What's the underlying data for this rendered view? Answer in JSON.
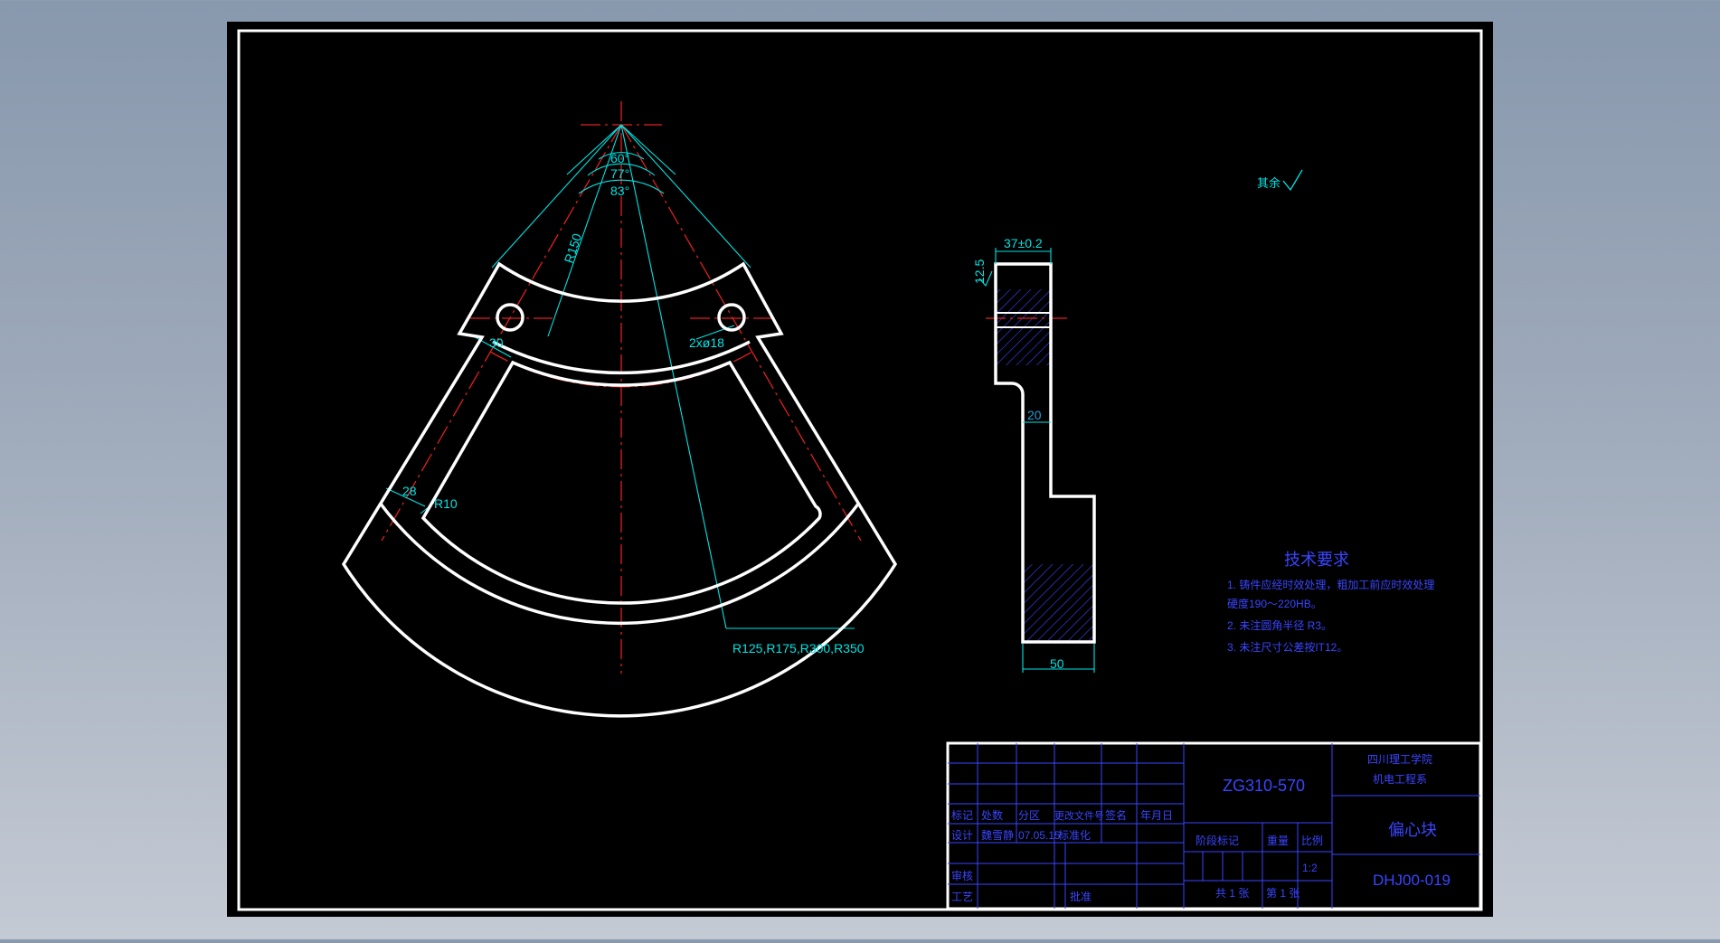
{
  "colors": {
    "background_top": "#8898ad",
    "canvas": "#000000",
    "outline": "#ffffff",
    "centerline": "#e02020",
    "dimension": "#00e5e5",
    "text_blue": "#3a45ff",
    "hatch": "#3a45ff"
  },
  "front_view": {
    "angles": [
      "60°",
      "77°",
      "83°"
    ],
    "radius_label": "R150",
    "hole_label": "2xø18",
    "width_label_30": "30",
    "width_label_28": "28",
    "fillet_label": "R10",
    "radii_label": "R125,R175,R300,R350"
  },
  "side_view": {
    "width_top": "37±0.2",
    "roughness": "12.5",
    "mid_width": "20",
    "bottom_width": "50"
  },
  "roughness_note": {
    "label": "其余"
  },
  "tech_requirements": {
    "title": "技术要求",
    "lines": [
      "1. 铸件应经时效处理，粗加工前应时效处理",
      "   硬度190～220HB。",
      "2. 未注圆角半径 R3。",
      "3. 未注尺寸公差按IT12。"
    ]
  },
  "title_block": {
    "material": "ZG310-570",
    "school_line1": "四川理工学院",
    "school_line2": "机电工程系",
    "part_name": "偏心块",
    "drawing_no": "DHJ00-019",
    "col_labels": [
      "标记",
      "处数",
      "分区",
      "更改文件号",
      "签名",
      "年月日"
    ],
    "design_label": "设计",
    "designer": "魏雪静",
    "date": "07.05.15",
    "standardize_label": "标准化",
    "review_label": "审核",
    "process_label": "工艺",
    "approve_label": "批准",
    "stage_label": "阶段标记",
    "weight_label": "重量",
    "scale_label": "比例",
    "scale_value": "1:2",
    "total_sheets": "共 1 张",
    "sheet_no": "第 1 张"
  }
}
